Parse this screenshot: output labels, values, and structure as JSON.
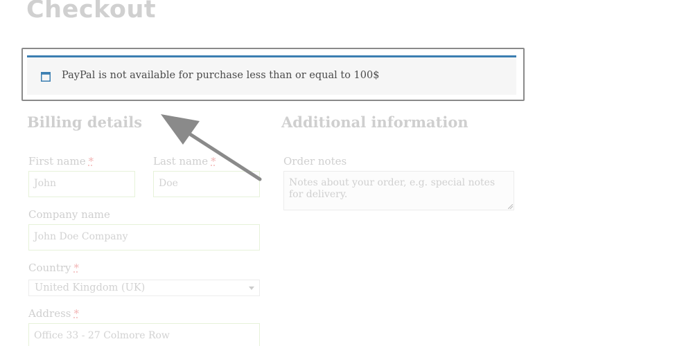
{
  "page": {
    "title": "Checkout"
  },
  "notice": {
    "icon": "window-icon",
    "text": "PayPal is not available for purchase less than or equal to 100$",
    "accent_color": "#3b7eb1"
  },
  "billing": {
    "heading": "Billing details",
    "first_name": {
      "label": "First name",
      "required_mark": "*",
      "value": "John"
    },
    "last_name": {
      "label": "Last name",
      "required_mark": "*",
      "value": "Doe"
    },
    "company": {
      "label": "Company name",
      "value": "John Doe Company"
    },
    "country": {
      "label": "Country",
      "required_mark": "*",
      "selected": "United Kingdom (UK)"
    },
    "address": {
      "label": "Address",
      "required_mark": "*",
      "value": "Office 33 - 27 Colmore Row"
    }
  },
  "additional": {
    "heading": "Additional information",
    "order_notes": {
      "label": "Order notes",
      "placeholder": "Notes about your order, e.g. special notes for delivery."
    }
  },
  "annotation": {
    "arrow_color": "#8a8a8a"
  }
}
